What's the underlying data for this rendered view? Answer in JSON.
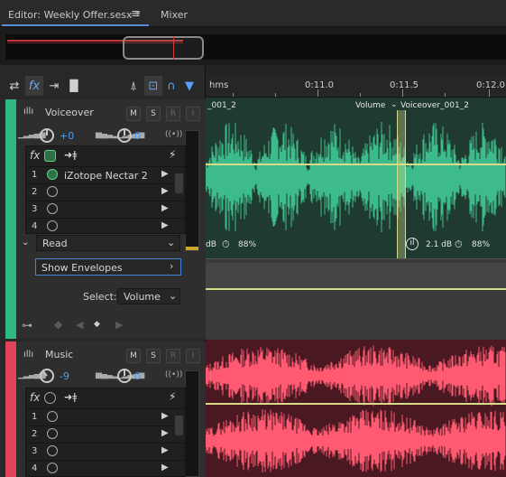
{
  "editor": {
    "tab_editor": "Editor: Weekly Offer.sesx *",
    "tab_menu_icon": "hamburger-icon",
    "tab_mixer": "Mixer"
  },
  "timeline": {
    "unit": "hms",
    "ticks": [
      "0:11.0",
      "0:11.5",
      "0:12.0"
    ]
  },
  "tracks": [
    {
      "name": "Voiceover",
      "color": "#2fb880",
      "volume": "+0",
      "pan": "0",
      "buttons": [
        "M",
        "S",
        "R",
        "I"
      ],
      "fx_slots": [
        {
          "num": "1",
          "name": "iZotope Nectar 2",
          "on": true
        },
        {
          "num": "2",
          "name": "",
          "on": false
        },
        {
          "num": "3",
          "name": "",
          "on": false
        },
        {
          "num": "4",
          "name": "",
          "on": false
        }
      ],
      "automation_mode": "Read",
      "envelopes_label": "Show Envelopes",
      "select_label": "Select:",
      "select_value": "Volume",
      "clip": {
        "left_name": "_001_2",
        "right_name": "Voiceover_001_2",
        "envelope_label": "Volume",
        "left_gain": "dB",
        "left_stretch": "88%",
        "right_gain": "2.1 dB",
        "right_stretch": "88%"
      }
    },
    {
      "name": "Music",
      "color": "#e0435a",
      "volume": "-9",
      "pan": "0",
      "buttons": [
        "M",
        "S",
        "R",
        "I"
      ],
      "fx_slots": [
        {
          "num": "1",
          "name": "",
          "on": false
        },
        {
          "num": "2",
          "name": "",
          "on": false
        },
        {
          "num": "3",
          "name": "",
          "on": false
        },
        {
          "num": "4",
          "name": "",
          "on": false
        }
      ]
    }
  ],
  "colors": {
    "voice_wave": "#3dbb8a",
    "voice_bg": "#1f3b31",
    "music_wave": "#ff5a72",
    "music_bg": "#4a1820",
    "envelope": "#d9d98a",
    "accent": "#4d9cf0"
  }
}
